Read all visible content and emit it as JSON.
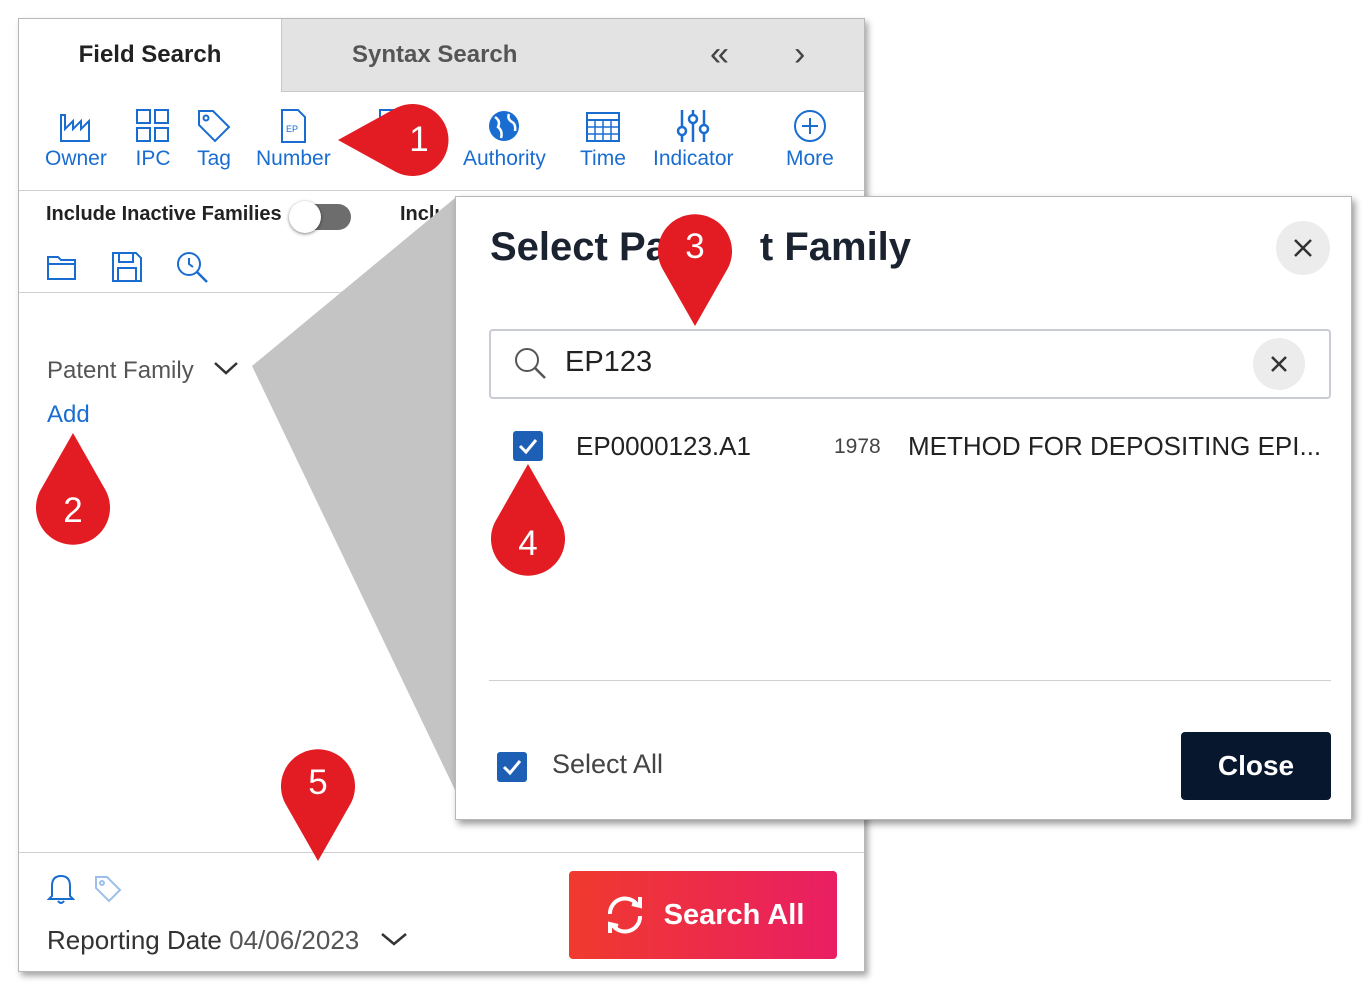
{
  "tabs": {
    "field_search": "Field Search",
    "syntax_search": "Syntax Search"
  },
  "toolbar": {
    "items": [
      {
        "label": "Owner",
        "icon": "factory-icon"
      },
      {
        "label": "IPC",
        "icon": "grid-icon"
      },
      {
        "label": "Tag",
        "icon": "tag-icon"
      },
      {
        "label": "Number",
        "icon": "ep-document-icon"
      },
      {
        "label": "Authority",
        "icon": "globe-icon"
      },
      {
        "label": "Time",
        "icon": "calendar-icon"
      },
      {
        "label": "Indicator",
        "icon": "sliders-icon"
      },
      {
        "label": "More",
        "icon": "plus-circle-icon"
      }
    ]
  },
  "options": {
    "include_inactive_families": "Include Inactive Families",
    "include_truncated": "Includ",
    "toggle_on": false
  },
  "criteria": {
    "patent_family_label": "Patent Family",
    "add_link": "Add"
  },
  "footer": {
    "reporting_label": "Reporting Date",
    "reporting_date": "04/06/2023",
    "search_all": "Search All"
  },
  "dialog": {
    "title_left": "Select Pa",
    "title_right": "t Family",
    "search_value": "EP123",
    "results": [
      {
        "number": "EP0000123.A1",
        "year": "1978",
        "title": "METHOD FOR DEPOSITING EPI...",
        "checked": true
      }
    ],
    "select_all_label": "Select All",
    "select_all_checked": true,
    "close_button": "Close"
  },
  "callouts": [
    "1",
    "2",
    "3",
    "4",
    "5"
  ],
  "colors": {
    "accent_blue": "#1a6dd0",
    "callout_red": "#e31b23",
    "search_gradient_start": "#f03a2e",
    "search_gradient_end": "#e91e63",
    "close_button_bg": "#07172e"
  }
}
